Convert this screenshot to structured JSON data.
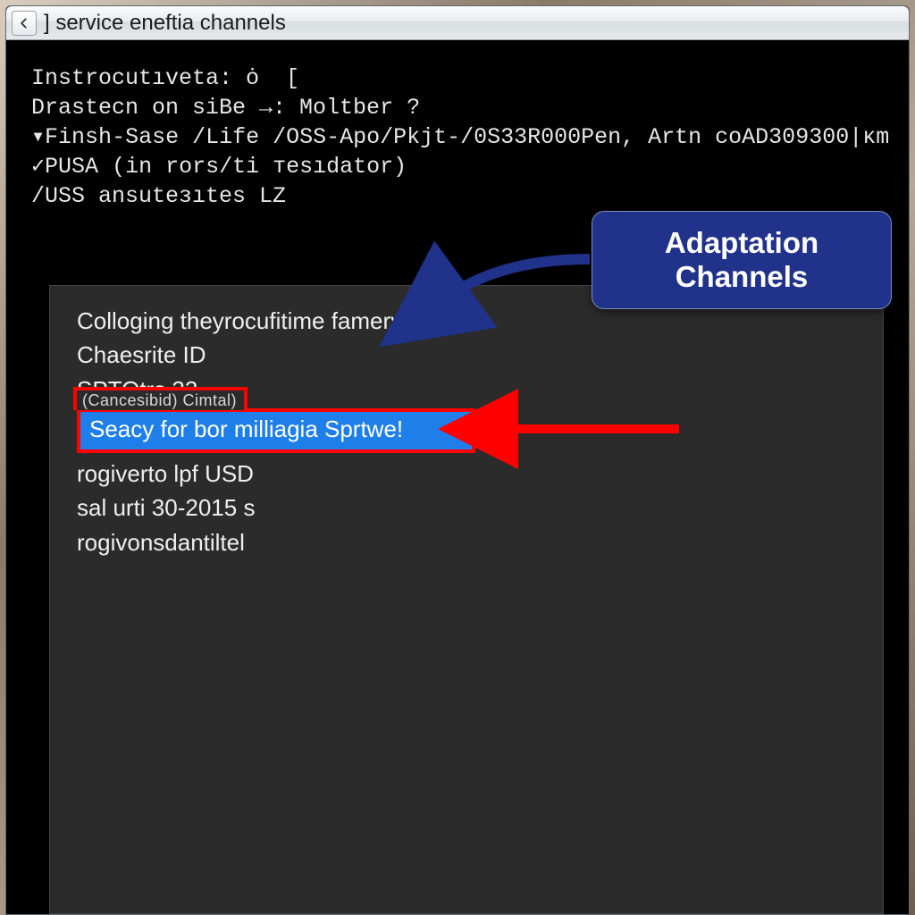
{
  "titlebar": {
    "title": "] service eneftia channels"
  },
  "terminal": {
    "lines": [
      "Instrocutıveta: ȯ  [",
      "Drastecn on siBe →: Moltber ?",
      "▾Finsh-Sase /Life /OSS-Apo/Pkjt-/0S33R000Pen, Artn coAD309300|ᴋm",
      "✓PUSA (in rors/ti тesıdator)",
      "/USS ansuteзıtes LZ"
    ]
  },
  "panel": {
    "items": [
      "Colloging theyrocufitime famery",
      "Chaesrite  ID",
      "SPTOtrs 33",
      "rogiverto lpf USD",
      "sal urti 30-2015  s",
      "rogivonsdantiltel"
    ],
    "selected_tab": "(Cancesibid) Cimtal)",
    "selected_text": "Seacy for bor milliagia Sprtwe!"
  },
  "callout": {
    "line1": "Adaptation",
    "line2": "Channels"
  }
}
